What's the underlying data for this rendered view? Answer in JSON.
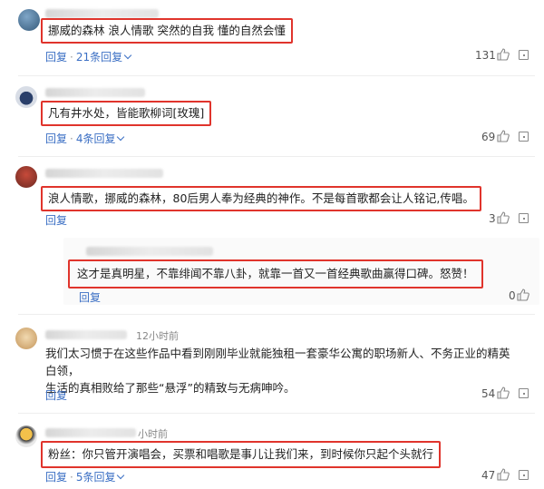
{
  "comments": [
    {
      "text": "挪威的森林 浪人情歌 突然的自我 懂的自然会懂",
      "reply_label": "回复",
      "sep": "·",
      "reply_count": "21条回复",
      "likes": "131"
    },
    {
      "text": "凡有井水处，皆能歌柳词[玫瑰]",
      "reply_label": "回复",
      "sep": "·",
      "reply_count": "4条回复",
      "likes": "69"
    },
    {
      "text": "浪人情歌，挪威的森林，80后男人奉为经典的神作。不是每首歌都会让人铭记,传唱。",
      "reply_label": "回复",
      "likes": "3"
    },
    {
      "text": "这才是真明星，不靠绯闻不靠八卦，就靠一首又一首经典歌曲赢得口碑。怒赞！",
      "reply_label": "回复",
      "likes": "0"
    },
    {
      "time": "12小时前",
      "text_line1": "我们太习惯于在这些作品中看到刚刚毕业就能独租一套豪华公寓的职场新人、不务正业的精英白领，",
      "text_line2": "生活的真相败给了那些“悬浮”的精致与无病呻吟。",
      "reply_label": "回复",
      "likes": "54"
    },
    {
      "time": "小时前",
      "text": "粉丝：你只管开演唱会，买票和唱歌是事儿让我们来，到时候你只起个头就行",
      "reply_label": "回复",
      "sep": "·",
      "reply_count": "5条回复",
      "likes": "47"
    }
  ],
  "colors": {
    "highlight": "#e0342c",
    "link": "#3b6fc4"
  },
  "icons": [
    "avatar",
    "thumbs-up-icon",
    "report-icon",
    "chevron-down-icon"
  ]
}
